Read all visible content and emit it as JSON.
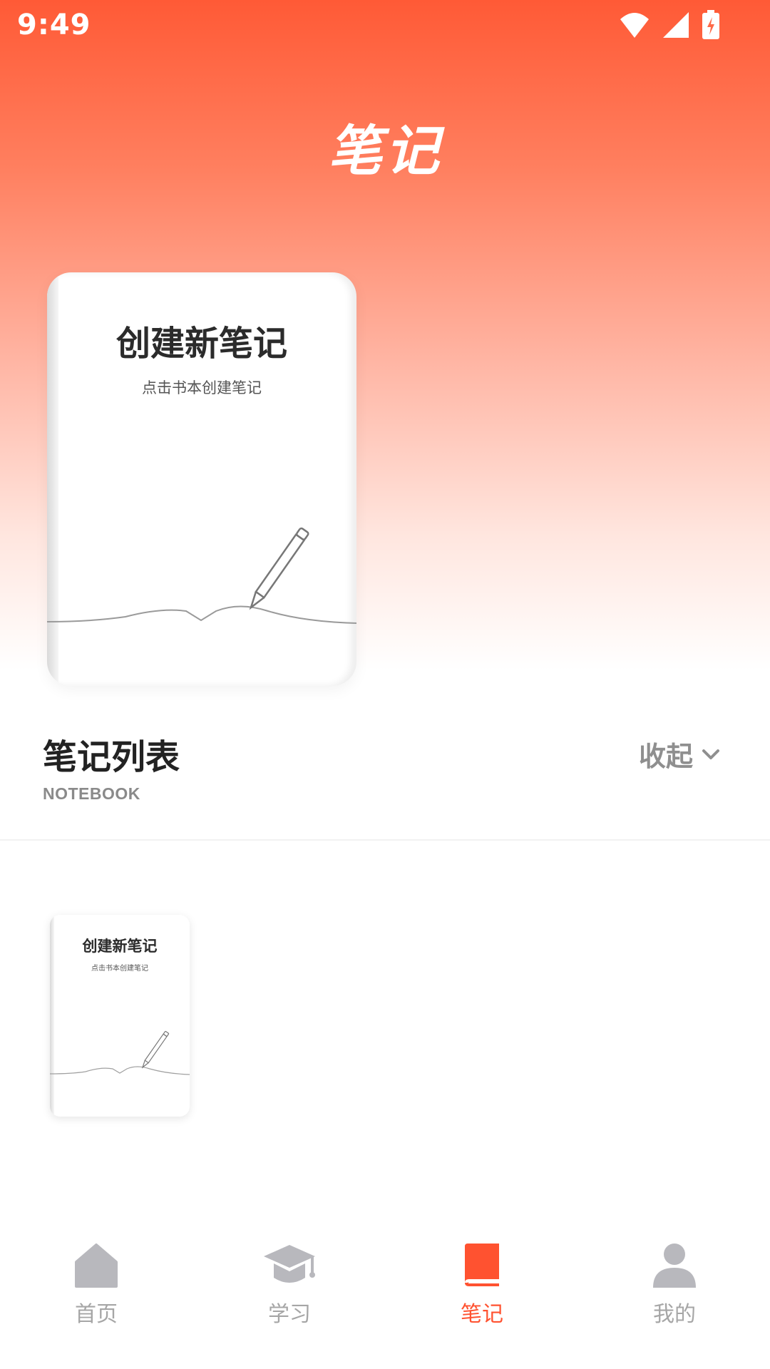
{
  "status_bar": {
    "time": "9:49"
  },
  "header": {
    "title": "笔记"
  },
  "create_notebook": {
    "title": "创建新笔记",
    "subtitle": "点击书本创建笔记"
  },
  "notebook_list": {
    "title": "笔记列表",
    "subtitle": "NOTEBOOK",
    "collapse_label": "收起"
  },
  "notebooks": [
    {
      "title": "创建新笔记",
      "subtitle": "点击书本创建笔记"
    }
  ],
  "tab_bar": {
    "items": [
      {
        "label": "首页",
        "icon": "home-icon",
        "active": false
      },
      {
        "label": "学习",
        "icon": "graduation-cap-icon",
        "active": false
      },
      {
        "label": "笔记",
        "icon": "notebook-icon",
        "active": true
      },
      {
        "label": "我的",
        "icon": "person-icon",
        "active": false
      }
    ]
  },
  "colors": {
    "accent": "#ff5230",
    "inactive": "#b8b8bd"
  }
}
